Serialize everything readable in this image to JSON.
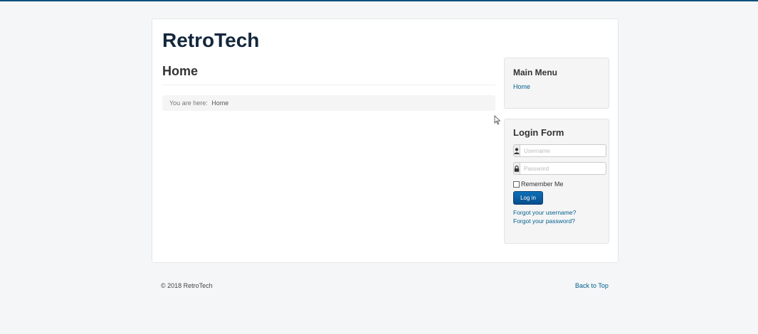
{
  "site": {
    "brand": "RetroTech"
  },
  "main": {
    "heading": "Home",
    "breadcrumb": {
      "prefix": "You are here:",
      "items": [
        "Home"
      ]
    }
  },
  "sidebar": {
    "main_menu": {
      "title": "Main Menu",
      "items": [
        "Home"
      ]
    },
    "login_form": {
      "title": "Login Form",
      "username_placeholder": "Username",
      "password_placeholder": "Password",
      "remember_label": "Remember Me",
      "login_button": "Log in",
      "forgot_username": "Forgot your username?",
      "forgot_password": "Forgot your password?",
      "icons": {
        "username": "user-icon",
        "password": "lock-icon"
      }
    }
  },
  "footer": {
    "copyright": "© 2018 RetroTech",
    "back_to_top": "Back to Top"
  },
  "colors": {
    "brand_dark": "#14273c",
    "link": "#005e8d",
    "button": "#0b5fa5",
    "top_border": "#0c4f7a"
  }
}
